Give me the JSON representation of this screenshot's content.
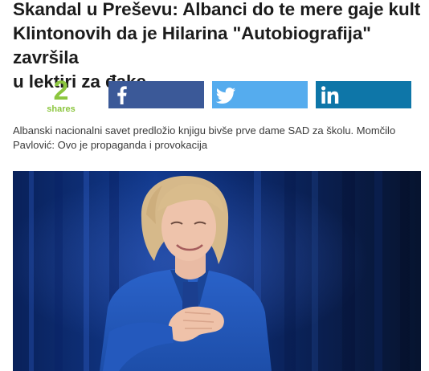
{
  "article": {
    "headline_lines": [
      "Skandal u Preševu: Albanci do te mere gaje kult",
      "Klintonovih da je Hilarina \"Autobiografija\" završila",
      "u lektiri za đake"
    ],
    "lead_lines": [
      "Albanski nacionalni savet predložio knjigu bivše prve dame SAD za školu. Momčilo",
      "Pavlović: Ovo je propaganda i provokacija"
    ]
  },
  "shares": {
    "count": "2",
    "label": "shares"
  },
  "share_buttons": [
    {
      "network": "facebook",
      "icon": "facebook-icon",
      "color": "#3b5998"
    },
    {
      "network": "twitter",
      "icon": "twitter-icon",
      "color": "#55acee"
    },
    {
      "network": "linkedin",
      "icon": "linkedin-icon",
      "color": "#0e76a8"
    }
  ],
  "colors": {
    "share_count": "#8cc63f",
    "headline": "#1c1c1c"
  }
}
